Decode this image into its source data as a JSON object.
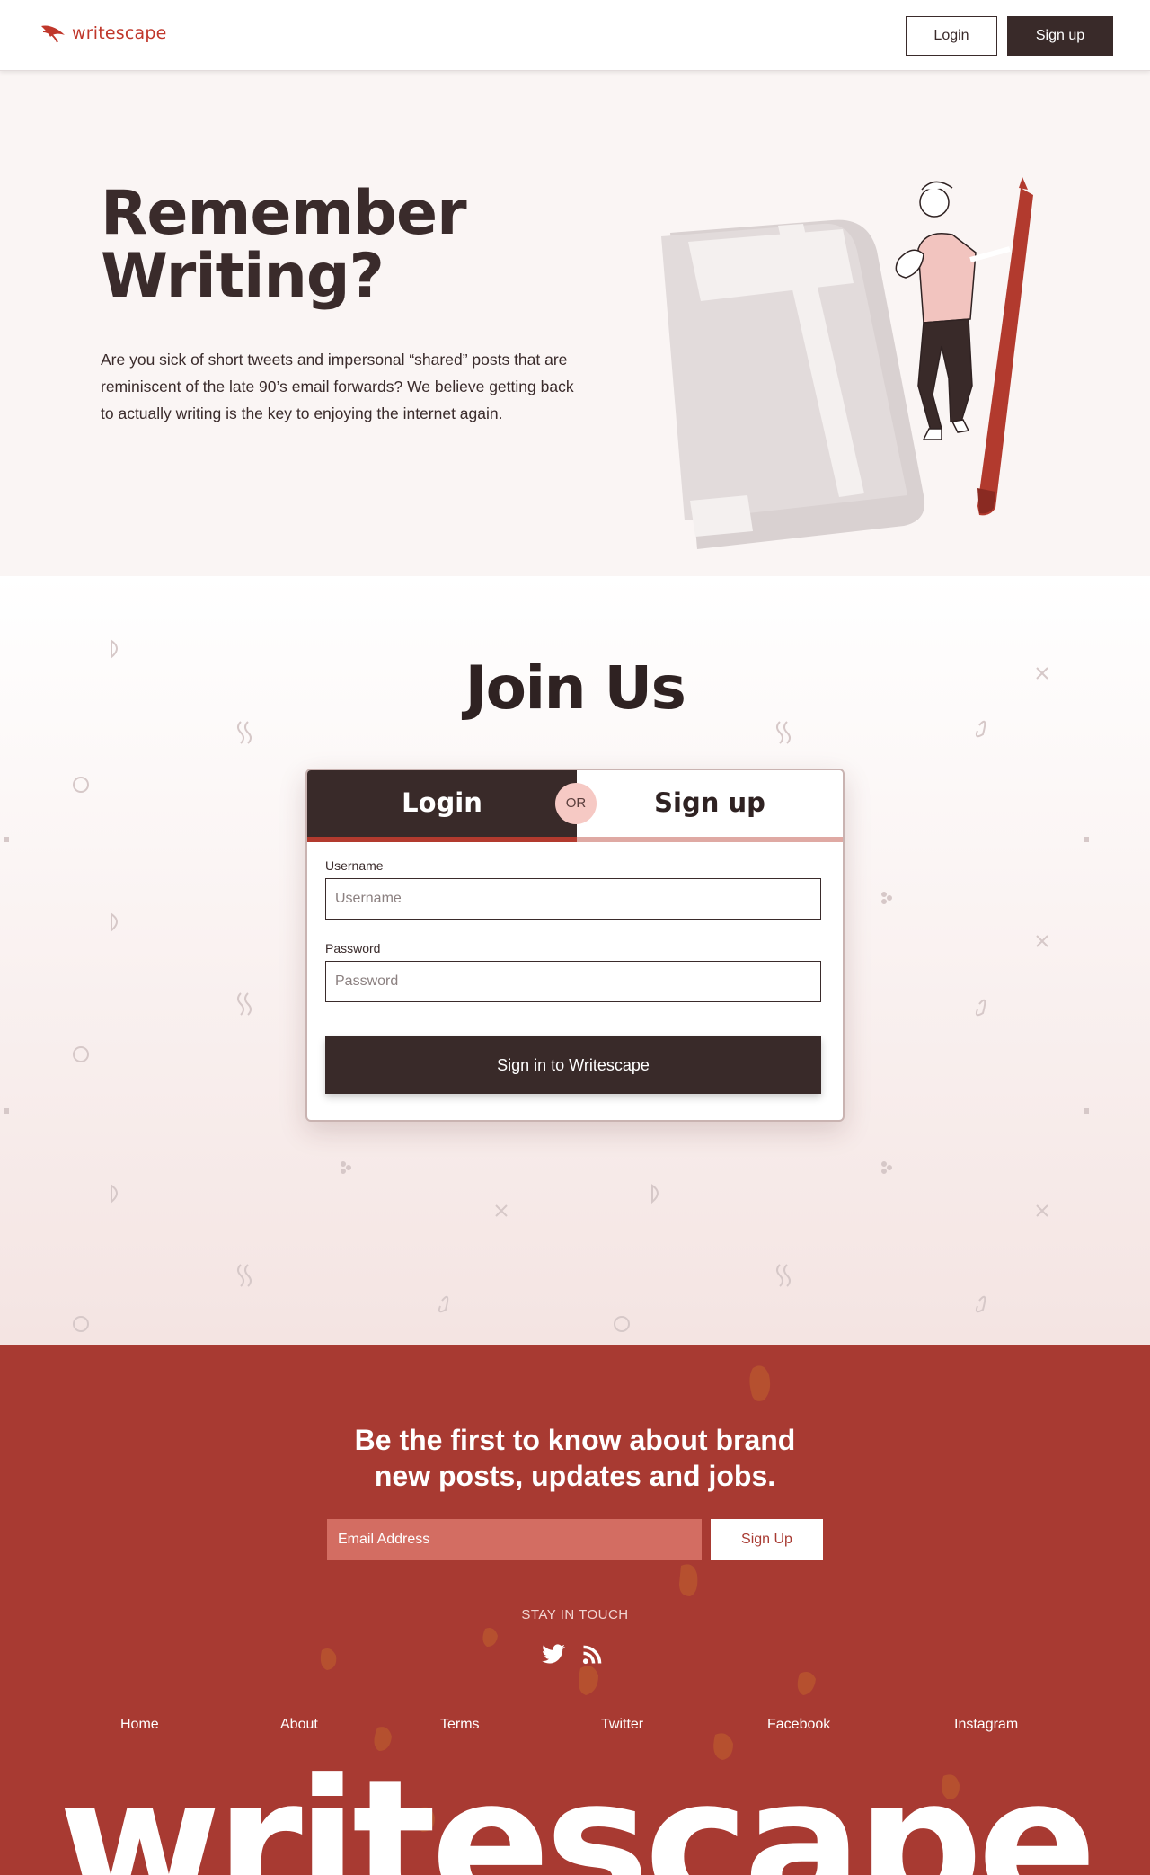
{
  "nav": {
    "brand": "writescape",
    "login_label": "Login",
    "signup_label": "Sign up"
  },
  "hero": {
    "title_line1": "Remember",
    "title_line2": "Writing?",
    "text": "Are you sick of short tweets and impersonal “shared” posts that are reminiscent of the late 90’s email forwards? We believe getting back to actually writing is the key to enjoying the internet again."
  },
  "join": {
    "title": "Join Us",
    "tab_login": "Login",
    "tab_signup": "Sign up",
    "or_label": "OR",
    "username_label": "Username",
    "username_placeholder": "Username",
    "password_label": "Password",
    "password_placeholder": "Password",
    "submit_label": "Sign in to Writescape"
  },
  "footer": {
    "news_line1": "Be the first to know about brand",
    "news_line2": "new posts, updates and jobs.",
    "email_placeholder": "Email Address",
    "signup_button": "Sign Up",
    "stay_in_touch": "STAY IN TOUCH",
    "social_icons": [
      "twitter-icon",
      "rss-icon"
    ],
    "links": [
      "Home",
      "About",
      "Terms",
      "Twitter",
      "Facebook",
      "Instagram"
    ],
    "big_word": "writescape"
  },
  "colors": {
    "brand_red": "#a83a32",
    "dark": "#392a29",
    "hero_bg": "#faf5f4",
    "accent_pink": "#f6c9c4"
  }
}
